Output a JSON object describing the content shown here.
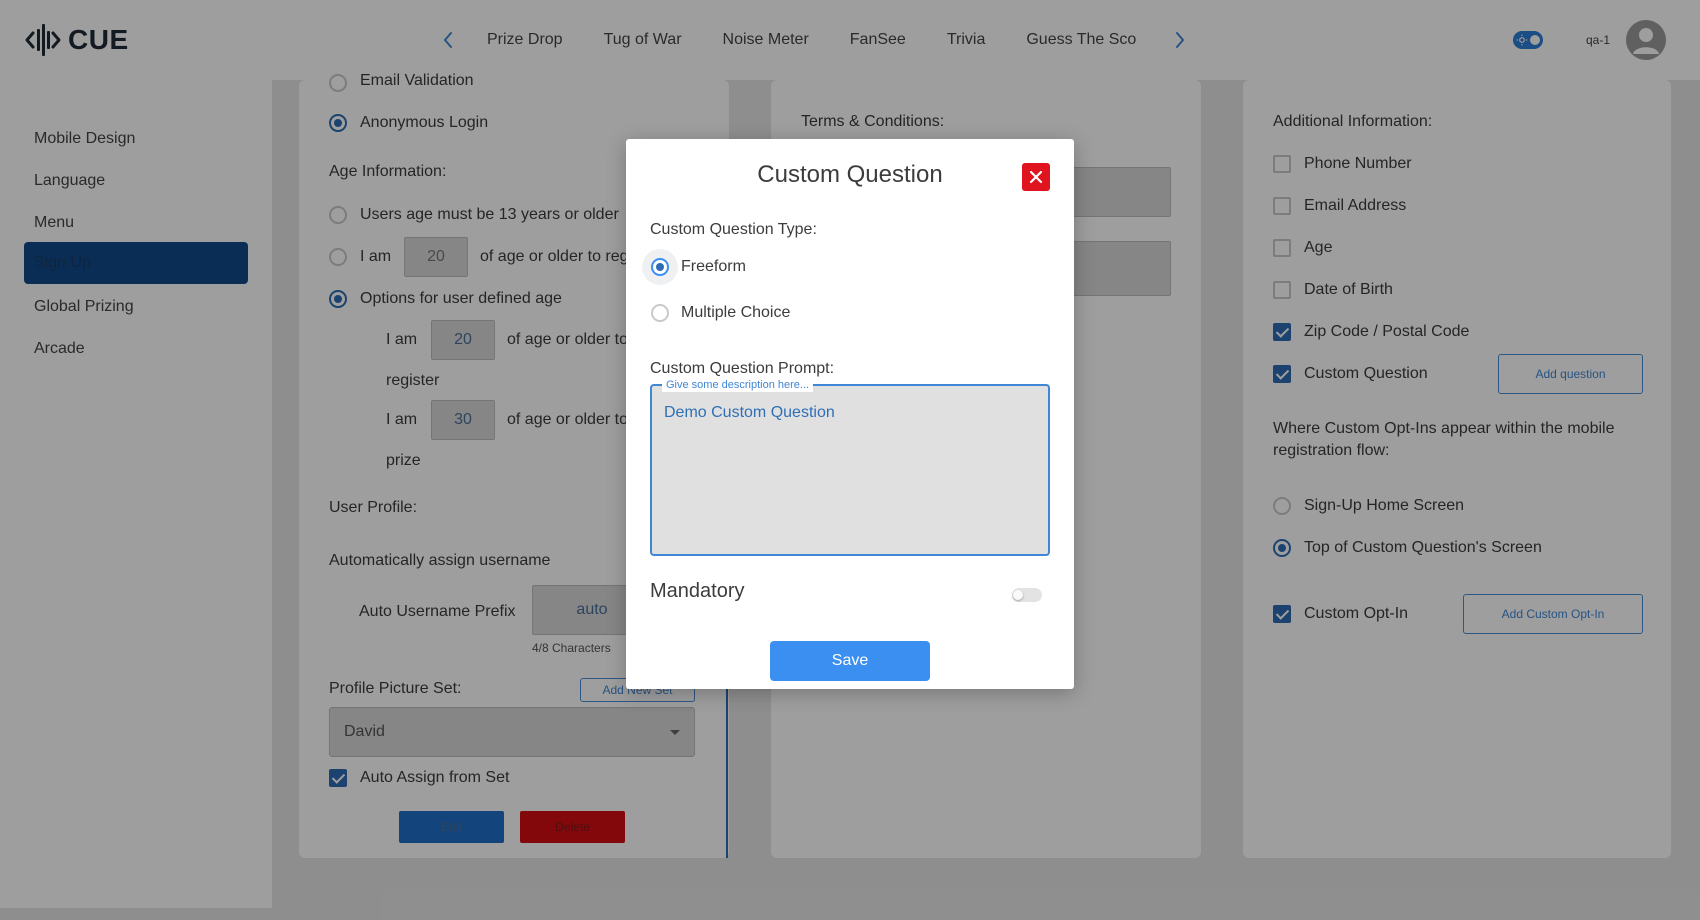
{
  "brand": {
    "name": "CUE"
  },
  "header": {
    "tabs": [
      "Prize Drop",
      "Tug of War",
      "Noise Meter",
      "FanSee",
      "Trivia",
      "Guess The Sco"
    ],
    "user_label": "qa-1"
  },
  "sidebar": {
    "items": [
      {
        "label": "Mobile Design"
      },
      {
        "label": "Language"
      },
      {
        "label": "Menu"
      },
      {
        "label": "Sign Up",
        "active": true
      },
      {
        "label": "Global Prizing"
      },
      {
        "label": "Arcade"
      }
    ]
  },
  "left_panel": {
    "email_validation": "Email Validation",
    "anonymous_login": "Anonymous Login",
    "age_info_heading": "Age Information:",
    "age_option_13": "Users age must be 13 years or older",
    "age_option_iam_prefix": "I am",
    "age_option_iam_value": "20",
    "age_option_iam_suffix": "of age or older to register",
    "age_option_user_defined": "Options for user defined age",
    "register_prefix": "I am",
    "register_value": "20",
    "register_suffix": "of age or older to",
    "register_word": "register",
    "prize_prefix": "I am",
    "prize_value": "30",
    "prize_suffix": "of age or older to",
    "prize_word": "prize",
    "user_profile_heading": "User Profile:",
    "auto_assign_username": "Automatically assign username",
    "auto_username_prefix_label": "Auto Username Prefix",
    "auto_username_prefix_value": "auto",
    "char_count": "4/8 Characters",
    "profile_picture_set_label": "Profile Picture Set:",
    "add_new_set": "Add New Set",
    "profile_set_selected": "David",
    "auto_assign_from_set": "Auto Assign from Set",
    "edit": "Edit",
    "delete": "Delete"
  },
  "middle_panel": {
    "terms_heading": "Terms & Conditions:"
  },
  "right_panel": {
    "additional_info_heading": "Additional Information:",
    "fields": [
      {
        "label": "Phone Number",
        "checked": false
      },
      {
        "label": "Email Address",
        "checked": false
      },
      {
        "label": "Age",
        "checked": false
      },
      {
        "label": "Date of Birth",
        "checked": false
      },
      {
        "label": "Zip Code / Postal Code",
        "checked": true
      },
      {
        "label": "Custom Question",
        "checked": true
      }
    ],
    "add_question": "Add question",
    "opt_in_location_heading": "Where Custom Opt-Ins appear within the mobile registration flow:",
    "opt_in_locations": [
      {
        "label": "Sign-Up Home Screen",
        "selected": false
      },
      {
        "label": "Top of Custom Question's Screen",
        "selected": true
      }
    ],
    "custom_opt_in": "Custom Opt-In",
    "add_custom_opt_in": "Add Custom Opt-In"
  },
  "modal": {
    "title": "Custom Question",
    "type_label": "Custom Question Type:",
    "type_options": [
      {
        "label": "Freeform",
        "selected": true
      },
      {
        "label": "Multiple Choice",
        "selected": false
      }
    ],
    "prompt_label": "Custom Question Prompt:",
    "prompt_placeholder": "Give some description here...",
    "prompt_value": "Demo Custom Question",
    "mandatory_label": "Mandatory",
    "mandatory_on": false,
    "save_label": "Save"
  },
  "colors": {
    "accent": "#3a8ff0",
    "nav_active": "#0f4a8a",
    "close_red": "#e0141e",
    "delete_red": "#d40d12",
    "edit_blue": "#1f6fc7"
  }
}
